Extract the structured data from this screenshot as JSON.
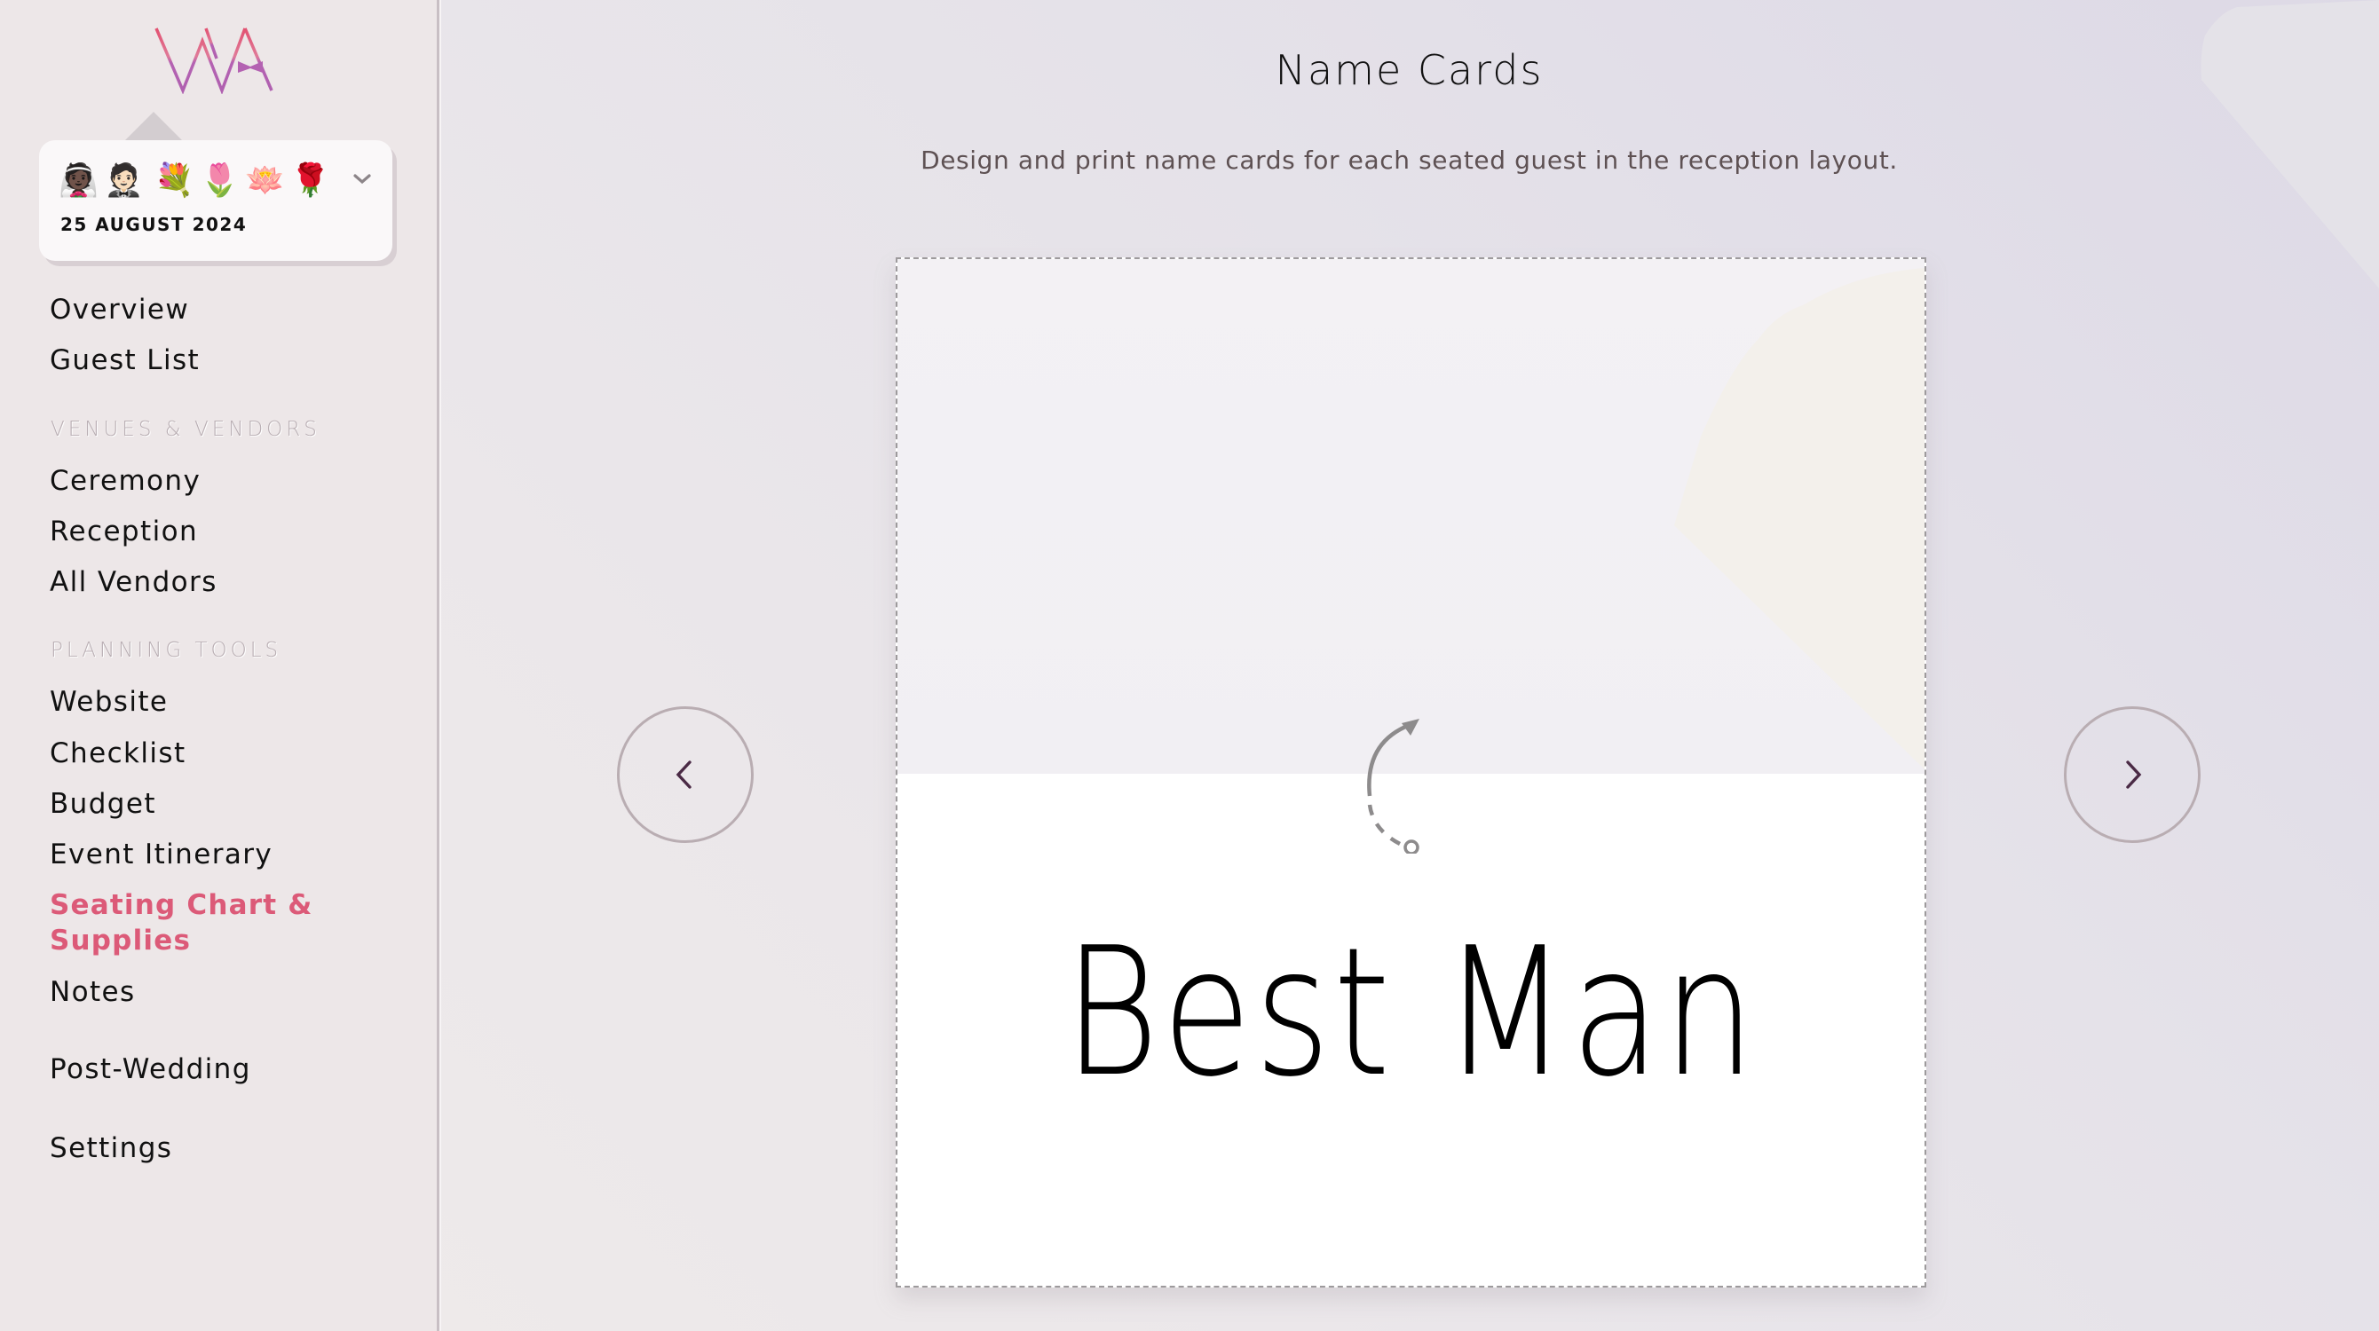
{
  "app": {
    "logo_text": "WA"
  },
  "event": {
    "emojis": [
      "👰🏿",
      "🤵🏻",
      "💐",
      "🌷",
      "🪷",
      "🌹"
    ],
    "date": "25 AUGUST 2024"
  },
  "sidebar": {
    "items_top": [
      {
        "label": "Overview"
      },
      {
        "label": "Guest List"
      }
    ],
    "sections": [
      {
        "title": "VENUES & VENDORS",
        "items": [
          {
            "label": "Ceremony"
          },
          {
            "label": "Reception"
          },
          {
            "label": "All Vendors"
          }
        ]
      },
      {
        "title": "PLANNING TOOLS",
        "items": [
          {
            "label": "Website"
          },
          {
            "label": "Checklist"
          },
          {
            "label": "Budget"
          },
          {
            "label": "Event Itinerary"
          },
          {
            "label": "Seating Chart & Supplies",
            "active": true
          },
          {
            "label": "Notes"
          }
        ]
      }
    ],
    "items_bottom": [
      {
        "label": "Post-Wedding"
      },
      {
        "label": "Settings"
      }
    ],
    "active_color": "#dc5a78"
  },
  "main": {
    "title": "Name Cards",
    "subtitle": "Design and print name cards for each seated guest in the reception layout.",
    "card": {
      "name": "Best Man",
      "flip_icon": "flip-card-icon"
    },
    "prev_icon": "chevron-left-icon",
    "next_icon": "chevron-right-icon"
  }
}
